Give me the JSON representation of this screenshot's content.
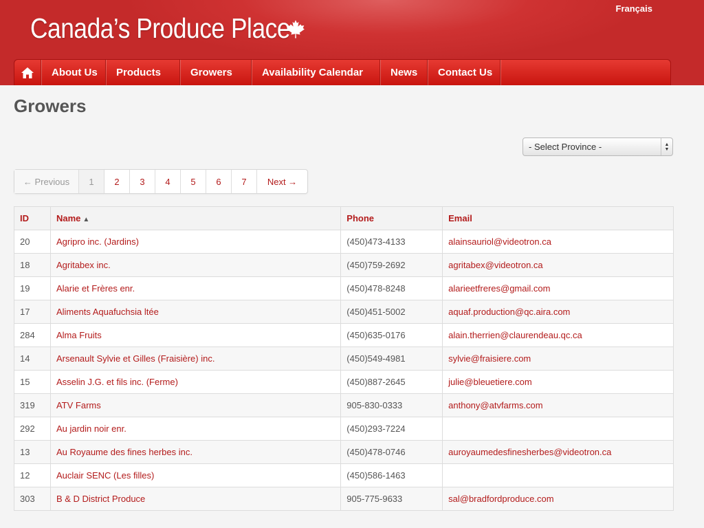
{
  "header": {
    "logo_text": "Canada’s Produce Place",
    "language_link": "Français"
  },
  "nav": {
    "home_icon": "home-icon",
    "items": [
      "About Us",
      "Products",
      "Growers",
      "Availability Calendar",
      "News",
      "Contact Us"
    ]
  },
  "page": {
    "title": "Growers"
  },
  "filter": {
    "province_selected": "- Select Province -"
  },
  "pagination": {
    "previous": "← Previous",
    "pages": [
      "1",
      "2",
      "3",
      "4",
      "5",
      "6",
      "7"
    ],
    "next": "Next →"
  },
  "table": {
    "columns": [
      "ID",
      "Name",
      "Phone",
      "Email"
    ],
    "sort_indicator": "▲",
    "rows": [
      [
        "20",
        "Agripro inc. (Jardins)",
        "(450)473-4133",
        "alainsauriol@videotron.ca"
      ],
      [
        "18",
        "Agritabex inc.",
        "(450)759-2692",
        "agritabex@videotron.ca"
      ],
      [
        "19",
        "Alarie et Frères enr.",
        "(450)478-8248",
        "alarieetfreres@gmail.com"
      ],
      [
        "17",
        "Aliments Aquafuchsia ltée",
        "(450)451-5002",
        "aquaf.production@qc.aira.com"
      ],
      [
        "284",
        "Alma Fruits",
        "(450)635-0176",
        "alain.therrien@claurendeau.qc.ca"
      ],
      [
        "14",
        "Arsenault Sylvie et Gilles (Fraisière) inc.",
        "(450)549-4981",
        "sylvie@fraisiere.com"
      ],
      [
        "15",
        "Asselin J.G. et fils inc. (Ferme)",
        "(450)887-2645",
        "julie@bleuetiere.com"
      ],
      [
        "319",
        "ATV Farms",
        "905-830-0333",
        "anthony@atvfarms.com"
      ],
      [
        "292",
        "Au jardin noir enr.",
        "(450)293-7224",
        ""
      ],
      [
        "13",
        "Au Royaume des fines herbes inc.",
        "(450)478-0746",
        "auroyaumedesfinesherbes@videotron.ca"
      ],
      [
        "12",
        "Auclair SENC (Les filles)",
        "(450)586-1463",
        ""
      ],
      [
        "303",
        "B & D District Produce",
        "905-775-9633",
        "sal@bradfordproduce.com"
      ]
    ]
  }
}
